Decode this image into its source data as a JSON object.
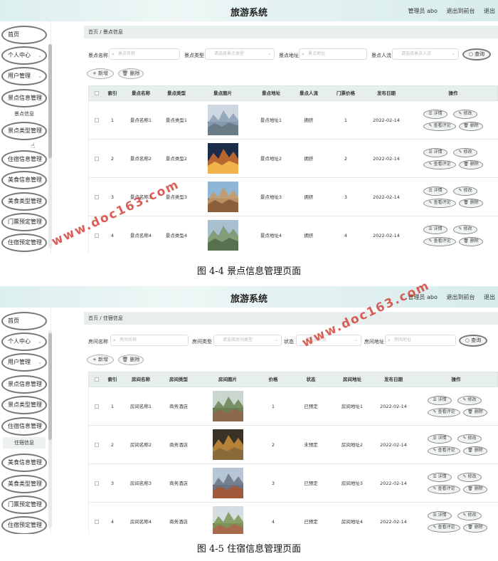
{
  "screens": [
    {
      "app_title": "旅游系统",
      "header_links": [
        "管理员 abo",
        "退出到前台",
        "退出"
      ],
      "nav": [
        "首页",
        "个人中心",
        "用户管理",
        "景点信息管理",
        "景点类型管理",
        "住宿信息管理",
        "美食信息管理",
        "美食类型管理",
        "门票预定管理",
        "住宿预定管理"
      ],
      "nav_sub": "景点信息",
      "breadcrumb": {
        "home": "首页",
        "sep": "/",
        "current": "景点信息"
      },
      "filters": [
        {
          "label": "景点名称",
          "placeholder": "景点名称",
          "type": "search"
        },
        {
          "label": "景点类型",
          "placeholder": "请选择景点类型",
          "type": "select"
        },
        {
          "label": "景点地址",
          "placeholder": "景点地址",
          "type": "search"
        },
        {
          "label": "景点人流",
          "placeholder": "请选择景点人流",
          "type": "select"
        }
      ],
      "query_label": "查询",
      "add_label": "+ 新增",
      "delete_label": "删除",
      "columns": [
        "索引",
        "景点名称",
        "景点类型",
        "景点图片",
        "景点地址",
        "景点人流",
        "门票价格",
        "发布日期",
        "操作"
      ],
      "rows": [
        [
          "1",
          "景点名称1",
          "景点类型1",
          "",
          "景点地址1",
          "拥挤",
          "1",
          "2022-02-14"
        ],
        [
          "2",
          "景点名称2",
          "景点类型2",
          "",
          "景点地址2",
          "拥挤",
          "2",
          "2022-02-14"
        ],
        [
          "3",
          "景点名称3",
          "景点类型3",
          "",
          "景点地址3",
          "拥挤",
          "3",
          "2022-02-14"
        ],
        [
          "4",
          "景点名称4",
          "景点类型4",
          "",
          "景点地址4",
          "拥挤",
          "4",
          "2022-02-14"
        ]
      ],
      "op_buttons": [
        "详情",
        "修改",
        "查看评论",
        "删除"
      ],
      "caption": "图 4-4  景点信息管理页面"
    },
    {
      "app_title": "旅游系统",
      "header_links": [
        "管理员 abo",
        "退出到前台",
        "退出"
      ],
      "nav": [
        "首页",
        "个人中心",
        "用户管理",
        "景点信息管理",
        "景点类型管理",
        "住宿信息管理",
        "美食信息管理",
        "美食类型管理",
        "门票预定管理",
        "住宿预定管理"
      ],
      "nav_sub": "住宿信息",
      "breadcrumb": {
        "home": "首页",
        "sep": "/",
        "current": "住宿信息"
      },
      "filters": [
        {
          "label": "房间名称",
          "placeholder": "房间名称",
          "type": "search"
        },
        {
          "label": "房间类型",
          "placeholder": "请选择房间类型",
          "type": "select"
        },
        {
          "label": "状态",
          "placeholder": "请选择状态",
          "type": "select"
        },
        {
          "label": "房间地址",
          "placeholder": "房间地址",
          "type": "search"
        }
      ],
      "query_label": "查询",
      "add_label": "+ 新增",
      "delete_label": "删除",
      "columns": [
        "索引",
        "房间名称",
        "房间类型",
        "房间图片",
        "价格",
        "状态",
        "房间地址",
        "发布日期",
        "操作"
      ],
      "rows": [
        [
          "1",
          "房间名称1",
          "商务酒店",
          "",
          "1",
          "已预定",
          "房间地址1",
          "2022-02-14"
        ],
        [
          "2",
          "房间名称2",
          "商务酒店",
          "",
          "2",
          "未预定",
          "房间地址2",
          "2022-02-14"
        ],
        [
          "3",
          "房间名称3",
          "商务酒店",
          "",
          "3",
          "已预定",
          "房间地址3",
          "2022-02-14"
        ],
        [
          "4",
          "房间名称4",
          "商务酒店",
          "",
          "4",
          "已预定",
          "房间地址4",
          "2022-02-14"
        ]
      ],
      "op_buttons": [
        "详情",
        "修改",
        "查看评论",
        "删除"
      ],
      "caption": "图 4-5  住宿信息管理页面"
    }
  ],
  "watermark": "www.doc163.com",
  "colors": {
    "accent": "#d4443a",
    "header": "#dcefee",
    "table_head": "#e6eeee"
  }
}
